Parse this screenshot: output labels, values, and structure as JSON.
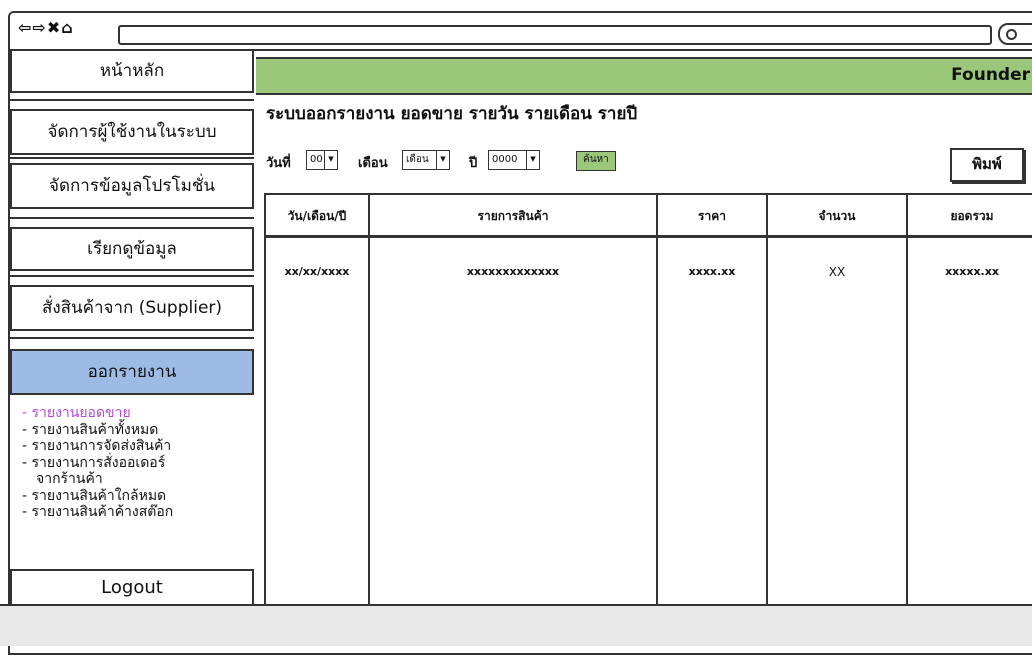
{
  "browser": {
    "nav_icons": "⇦⇨✖⌂"
  },
  "sidebar": {
    "items": [
      {
        "label": "หน้าหลัก"
      },
      {
        "label": "จัดการผู้ใช้งานในระบบ"
      },
      {
        "label": "จัดการข้อมูลโปรโมชั่น"
      },
      {
        "label": "เรียกดูข้อมูล"
      },
      {
        "label": "สั่งสินค้าจาก (Supplier)"
      },
      {
        "label": "ออกรายงาน"
      }
    ],
    "submenu": [
      "- รายงานยอดขาย",
      "- รายงานสินค้าทั้งหมด",
      "- รายงานการจัดส่งสินค้า",
      "- รายงานการสั่งออเดอร์",
      "จากร้านค้า",
      "- รายงานสินค้าใกล้หมด",
      "- รายงานสินค้าค้างสต๊อก"
    ],
    "logout": "Logout"
  },
  "header": {
    "founder": "Founder"
  },
  "report": {
    "title": "ระบบออกรายงาน ยอดขาย รายวัน รายเดือน รายปี",
    "filters": {
      "day_label": "วันที่",
      "day_value": "00",
      "month_label": "เดือน",
      "month_value": "เดือน",
      "year_label": "ปี",
      "year_value": "0000",
      "search_label": "ค้นหา"
    },
    "print_label": "พิมพ์"
  },
  "table": {
    "headers": [
      "วัน/เดือน/ปี",
      "รายการสินค้า",
      "ราคา",
      "จำนวน",
      "ยอดรวม"
    ],
    "rows": [
      [
        "xx/xx/xxxx",
        "xxxxxxxxxxxxx",
        "xxxx.xx",
        "XX",
        "xxxxx.xx"
      ]
    ]
  }
}
